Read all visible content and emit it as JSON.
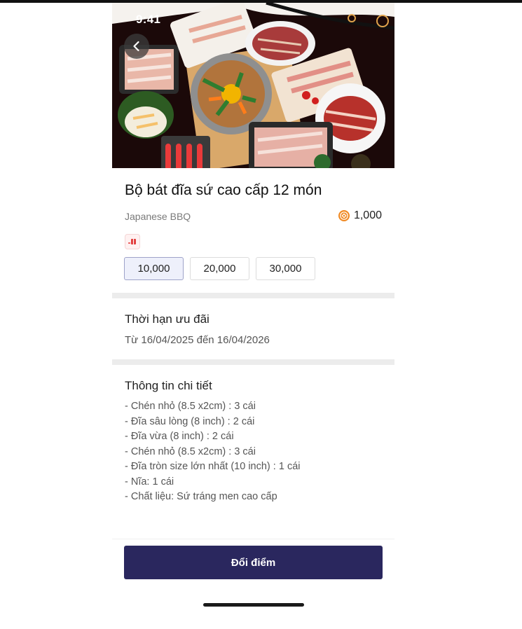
{
  "status_bar": {
    "time": "9:41"
  },
  "product": {
    "title": "Bộ bát đĩa sứ cao cấp 12 món",
    "brand": "Japanese BBQ",
    "points": "1,000"
  },
  "options": [
    {
      "label": "10,000",
      "selected": true
    },
    {
      "label": "20,000",
      "selected": false
    },
    {
      "label": "30,000",
      "selected": false
    }
  ],
  "validity": {
    "heading": "Thời hạn ưu đãi",
    "text": "Từ 16/04/2025 đến 16/04/2026"
  },
  "details": {
    "heading": "Thông tin chi tiết",
    "items": [
      "- Chén nhỏ (8.5 x2cm) : 3 cái",
      "- Đĩa sâu lòng (8 inch) : 2 cái",
      "- Đĩa vừa (8 inch) : 2 cái",
      "- Chén nhỏ (8.5 x2cm) : 3 cái",
      "- Đĩa tròn size lớn nhất (10 inch) : 1 cái",
      "- Nĩa: 1 cái",
      "- Chất liệu: Sứ tráng men cao cấp"
    ]
  },
  "cta": {
    "label": "Đổi điểm"
  },
  "colors": {
    "accent": "#2a275e",
    "coin": "#f08a24",
    "selected_bg": "#eef0fb"
  }
}
